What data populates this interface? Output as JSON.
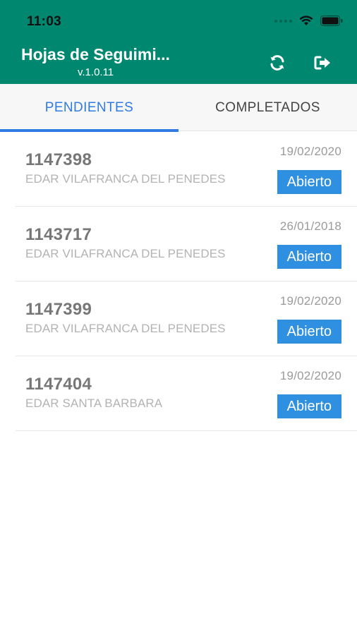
{
  "status_bar": {
    "time": "11:03"
  },
  "header": {
    "title": "Hojas de Seguimi...",
    "version": "v.1.0.11",
    "refresh_icon": "refresh-icon",
    "logout_icon": "logout-icon"
  },
  "tabs": [
    {
      "label": "PENDIENTES",
      "active": true
    },
    {
      "label": "COMPLETADOS",
      "active": false
    }
  ],
  "colors": {
    "header": "#00876f",
    "accent": "#2f7be3",
    "badge": "#2f8fe0"
  },
  "items": [
    {
      "id": "1147398",
      "place": "EDAR VILAFRANCA DEL PENEDES",
      "date": "19/02/2020",
      "status": "Abierto"
    },
    {
      "id": "1143717",
      "place": "EDAR VILAFRANCA DEL PENEDES",
      "date": "26/01/2018",
      "status": "Abierto"
    },
    {
      "id": "1147399",
      "place": "EDAR VILAFRANCA DEL PENEDES",
      "date": "19/02/2020",
      "status": "Abierto"
    },
    {
      "id": "1147404",
      "place": "EDAR SANTA BARBARA",
      "date": "19/02/2020",
      "status": "Abierto"
    }
  ]
}
